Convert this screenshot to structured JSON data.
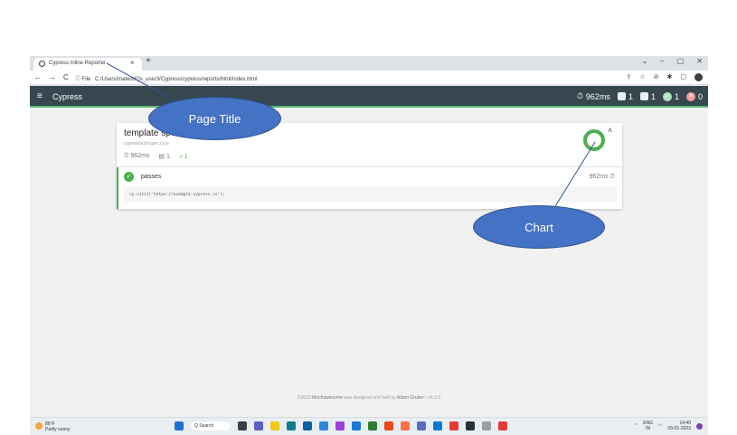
{
  "browser": {
    "tab_title": "Cypress Inline Reporter",
    "tab_close": "×",
    "new_tab": "+",
    "win_controls": [
      "⌄",
      "–",
      "▢",
      "✕"
    ],
    "nav": [
      "←",
      "→",
      "C"
    ],
    "url_prefix": "ⓘ File",
    "url": "C:/Users/mateoriQs_user3/Cypress/cypress/reports/html/index.html",
    "ext_icons": [
      "⇪",
      "☆",
      "⊘",
      "✱",
      "▢"
    ]
  },
  "navbar": {
    "menu_icon": "≡",
    "title": "Cypress",
    "duration": "962ms",
    "suites": "1",
    "tests": "1",
    "passes": "1",
    "failures": "0"
  },
  "suite": {
    "title": "template spec",
    "file": "cypress\\e2e\\spec.cy.js",
    "duration": "962ms",
    "tests": "1",
    "passes": "✓1",
    "collapse": "˄",
    "chart_pass_fraction": 1.0,
    "chart_color": "#4caf50"
  },
  "test": {
    "title": "passes",
    "duration": "962ms",
    "code": "cy.visit('https://example.cypress.io');"
  },
  "footer": {
    "prefix": "©2023",
    "brand": "Mochawesome",
    "middle": "was designed and built by",
    "author": "Adam Gruber",
    "version": "• v6.2.0"
  },
  "taskbar": {
    "temp": "86°F",
    "weather": "Partly sunny",
    "search": "Q Search",
    "lang": "ENG",
    "region": "IN",
    "time": "14:40",
    "date": "09-01-2023"
  },
  "annotations": {
    "page_title": "Page Title",
    "chart": "Chart"
  },
  "colors": {
    "navbar": "#37474f",
    "pass": "#4caf50",
    "annotation": "#4472c4"
  }
}
